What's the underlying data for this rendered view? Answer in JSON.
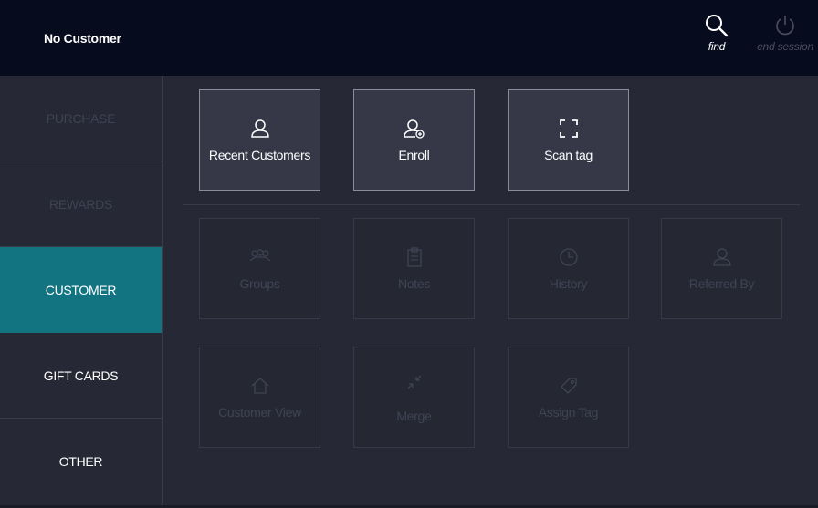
{
  "header": {
    "customer_name": "No Customer",
    "find_label": "find",
    "end_session_label": "end session"
  },
  "sidebar": {
    "items": [
      {
        "label": "PURCHASE",
        "state": "disabled"
      },
      {
        "label": "REWARDS",
        "state": "disabled"
      },
      {
        "label": "CUSTOMER",
        "state": "active"
      },
      {
        "label": "GIFT CARDS",
        "state": "enabled"
      },
      {
        "label": "OTHER",
        "state": "enabled"
      }
    ]
  },
  "main": {
    "actions": [
      {
        "label": "Recent Customers",
        "icon": "user-icon",
        "enabled": true
      },
      {
        "label": "Enroll",
        "icon": "user-add-icon",
        "enabled": true
      },
      {
        "label": "Scan tag",
        "icon": "scan-icon",
        "enabled": true
      }
    ],
    "options": [
      {
        "label": "Groups",
        "icon": "group-icon",
        "enabled": false
      },
      {
        "label": "Notes",
        "icon": "clipboard-icon",
        "enabled": false
      },
      {
        "label": "History",
        "icon": "clock-icon",
        "enabled": false
      },
      {
        "label": "Referred By",
        "icon": "user-icon",
        "enabled": false
      },
      {
        "label": "Customer View",
        "icon": "home-icon",
        "enabled": false
      },
      {
        "label": "Merge",
        "icon": "merge-icon",
        "enabled": false
      },
      {
        "label": "Assign Tag",
        "icon": "tag-icon",
        "enabled": false
      }
    ]
  },
  "colors": {
    "header_bg": "#060b1e",
    "panel_bg": "#262835",
    "active_tab": "#127480",
    "tile_enabled_bg": "#363848",
    "tile_disabled_text": "#3f4353"
  }
}
